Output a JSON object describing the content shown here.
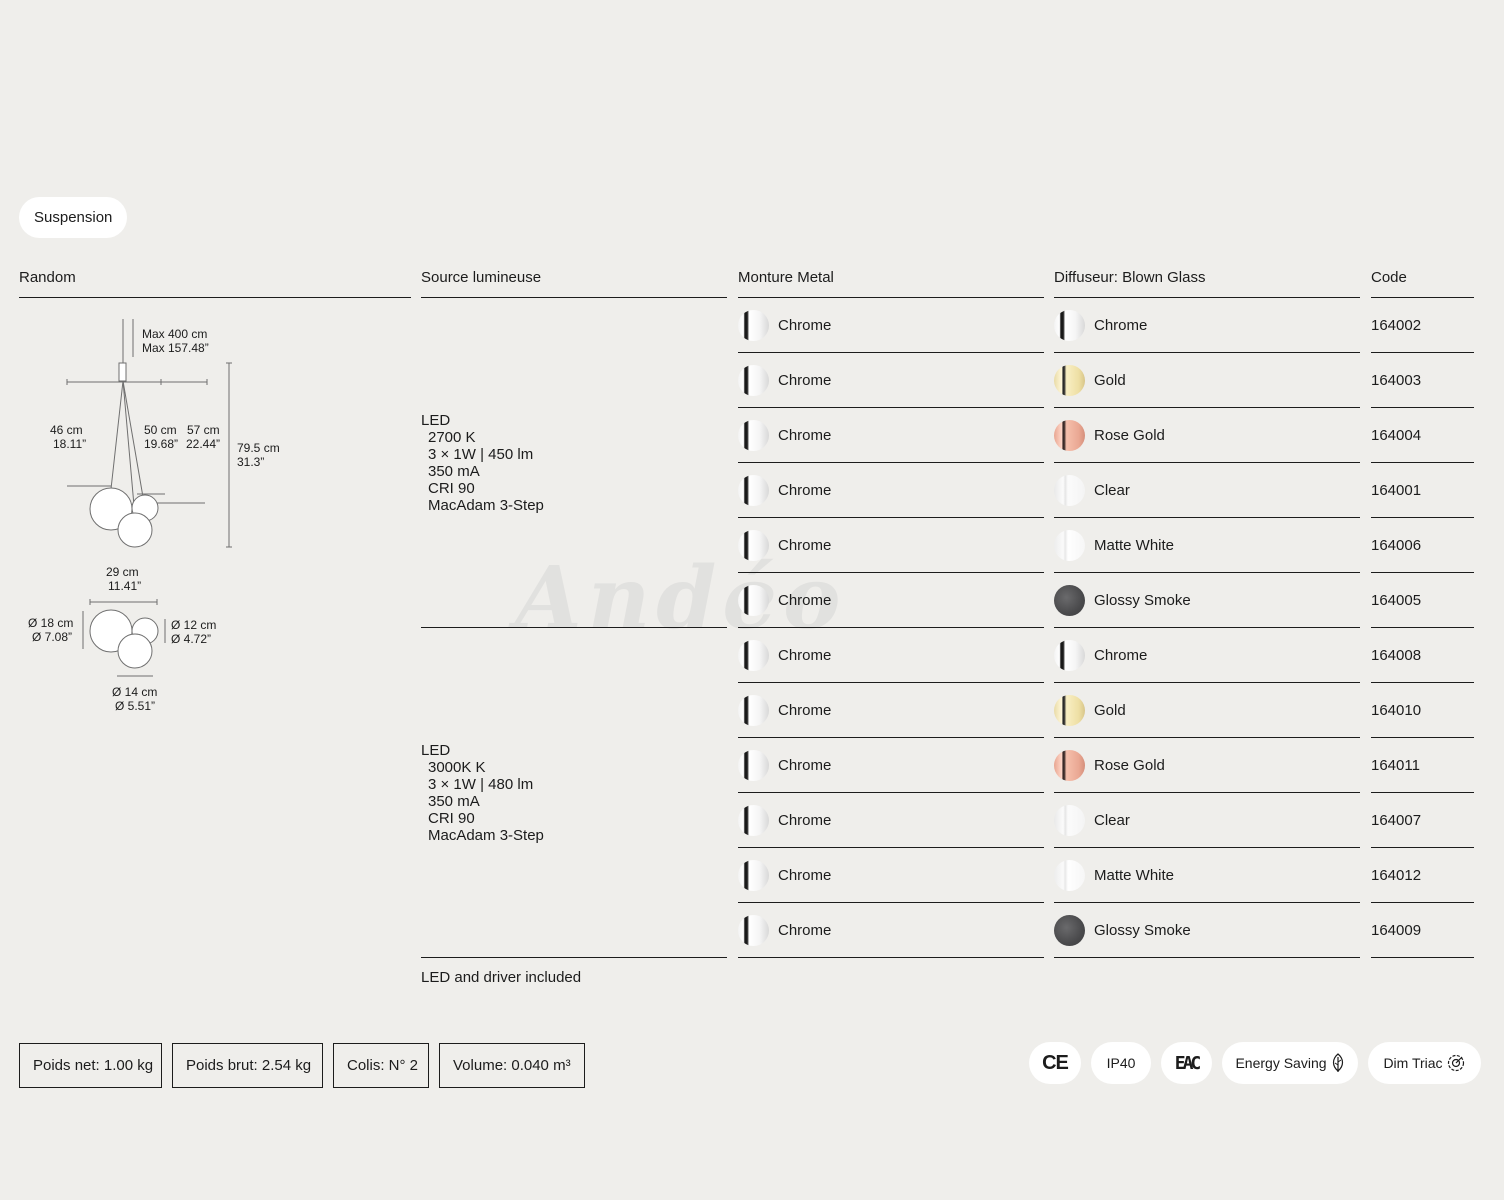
{
  "tab": {
    "label": "Suspension"
  },
  "headers": {
    "random": "Random",
    "source": "Source lumineuse",
    "monture": "Monture Metal",
    "diffuseur": "Diffuseur: Blown Glass",
    "code": "Code"
  },
  "diagram": {
    "max_cm": "Max 400 cm",
    "max_in": "Max 157.48”",
    "d46_cm": "46 cm",
    "d46_in": "18.11”",
    "d50_cm": "50 cm",
    "d50_in": "19.68”",
    "d57_cm": "57 cm",
    "d57_in": "22.44”",
    "d795_cm": "79.5 cm",
    "d795_in": "31.3”",
    "d29_cm": "29 cm",
    "d29_in": "11.41”",
    "o18_cm": "Ø 18 cm",
    "o18_in": "Ø 7.08”",
    "o12_cm": "Ø 12 cm",
    "o12_in": "Ø 4.72”",
    "o14_cm": "Ø 14 cm",
    "o14_in": "Ø 5.51”"
  },
  "sources": [
    {
      "type": "LED",
      "lines": [
        "2700 K",
        "3 × 1W | 450 lm",
        "350 mA",
        "CRI 90",
        "MacAdam 3-Step"
      ]
    },
    {
      "type": "LED",
      "lines": [
        "3000K K",
        "3 × 1W | 480 lm",
        "350 mA",
        "CRI 90",
        "MacAdam 3-Step"
      ]
    }
  ],
  "rows": [
    {
      "monture": "Chrome",
      "diffuseur": "Chrome",
      "swatch": "chrome",
      "code": "164002"
    },
    {
      "monture": "Chrome",
      "diffuseur": "Gold",
      "swatch": "gold",
      "code": "164003"
    },
    {
      "monture": "Chrome",
      "diffuseur": "Rose Gold",
      "swatch": "rose",
      "code": "164004"
    },
    {
      "monture": "Chrome",
      "diffuseur": "Clear",
      "swatch": "clear",
      "code": "164001"
    },
    {
      "monture": "Chrome",
      "diffuseur": "Matte White",
      "swatch": "white",
      "code": "164006"
    },
    {
      "monture": "Chrome",
      "diffuseur": "Glossy Smoke",
      "swatch": "smoke",
      "code": "164005"
    },
    {
      "monture": "Chrome",
      "diffuseur": "Chrome",
      "swatch": "chrome",
      "code": "164008"
    },
    {
      "monture": "Chrome",
      "diffuseur": "Gold",
      "swatch": "gold",
      "code": "164010"
    },
    {
      "monture": "Chrome",
      "diffuseur": "Rose Gold",
      "swatch": "rose",
      "code": "164011"
    },
    {
      "monture": "Chrome",
      "diffuseur": "Clear",
      "swatch": "clear",
      "code": "164007"
    },
    {
      "monture": "Chrome",
      "diffuseur": "Matte White",
      "swatch": "white",
      "code": "164012"
    },
    {
      "monture": "Chrome",
      "diffuseur": "Glossy Smoke",
      "swatch": "smoke",
      "code": "164009"
    }
  ],
  "note": "LED and driver included",
  "info": {
    "poids_net": "Poids net: 1.00 kg",
    "poids_brut": "Poids brut: 2.54 kg",
    "colis": "Colis: N° 2",
    "volume": "Volume: 0.040 m³"
  },
  "badges": {
    "ce": "CE",
    "ip": "IP40",
    "eac": "EAC",
    "energy": "Energy Saving",
    "dim": "Dim Triac"
  },
  "watermark": "Andéo"
}
